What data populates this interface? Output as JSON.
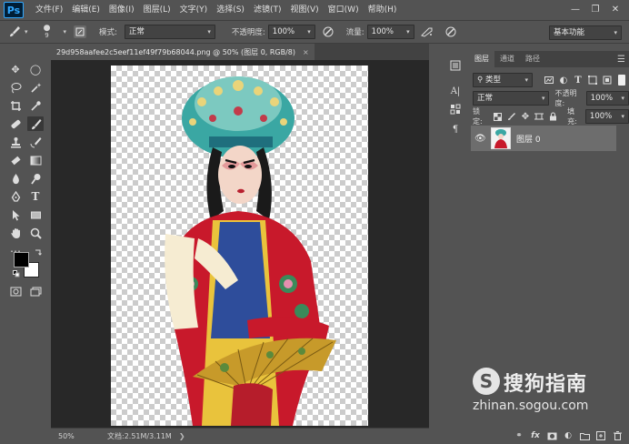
{
  "app": {
    "logo": "Ps"
  },
  "menu": [
    "文件(F)",
    "编辑(E)",
    "图像(I)",
    "图层(L)",
    "文字(Y)",
    "选择(S)",
    "滤镜(T)",
    "视图(V)",
    "窗口(W)",
    "帮助(H)"
  ],
  "options": {
    "brush_size": "9",
    "mode_label": "模式:",
    "mode_value": "正常",
    "opacity_label": "不透明度:",
    "opacity_value": "100%",
    "flow_label": "流量:",
    "flow_value": "100%",
    "workspace": "基本功能"
  },
  "document": {
    "tab_title": "29d958aafee2c5eef11ef49f79b68044.png @ 50% (图层 0, RGB/8)",
    "tab_close": "×",
    "zoom": "50%",
    "doc_info": "文档:2.51M/3.11M"
  },
  "layers_panel": {
    "tabs": [
      "图层",
      "通道",
      "路径"
    ],
    "filter_kind": "类型",
    "blend_mode": "正常",
    "opacity_label": "不透明度:",
    "opacity_value": "100%",
    "lock_label": "锁定:",
    "fill_label": "填充:",
    "fill_value": "100%",
    "layers": [
      {
        "name": "图层 0",
        "visible": true
      }
    ],
    "footer_fx": "fx"
  },
  "watermark": {
    "title": "搜狗指南",
    "url": "zhinan.sogou.com",
    "logo_letter": "S"
  },
  "colors": {
    "foreground": "#000000",
    "background": "#ffffff",
    "ui_bg": "#535353",
    "ui_dark": "#282828",
    "accent": "#31a8ff"
  }
}
